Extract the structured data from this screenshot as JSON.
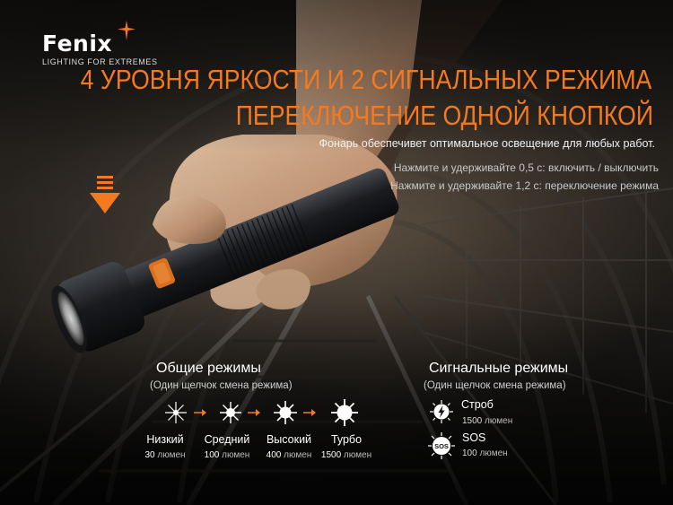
{
  "brand": {
    "name": "Fenix",
    "tagline": "LIGHTING FOR EXTREMES"
  },
  "headline": {
    "line1": "4 УРОВНЯ ЯРКОСТИ И 2 СИГНАЛЬНЫХ РЕЖИМА",
    "line2": "ПЕРЕКЛЮЧЕНИЕ ОДНОЙ КНОПКОЙ",
    "subtitle": "Фонарь обеспечивет оптимальное освещение для любых работ."
  },
  "instructions": [
    "Нажмите и удерживайте 0,5 с: включить / выключить",
    "Нажмите и удерживайте 1,2 с: переключение режима"
  ],
  "general_modes": {
    "title": "Общие  режимы",
    "subtitle": "(Один щелчок смена режима)",
    "modes": [
      {
        "name": "Низкий",
        "lumens": "30",
        "unit": "люмен"
      },
      {
        "name": "Средний",
        "lumens": "100",
        "unit": "люмен"
      },
      {
        "name": "Высокий",
        "lumens": "400",
        "unit": "люмен"
      },
      {
        "name": "Турбо",
        "lumens": "1500",
        "unit": "люмен"
      }
    ]
  },
  "signal_modes": {
    "title": "Сигнальные режимы",
    "subtitle": "(Один щелчок смена режима)",
    "modes": [
      {
        "name": "Строб",
        "lumens": "1500",
        "unit": "люмен"
      },
      {
        "name": "SOS",
        "lumens": "100",
        "unit": "люмен"
      }
    ],
    "sos_icon_text": "SOS"
  },
  "colors": {
    "accent": "#f47a20",
    "text": "#ffffff"
  },
  "icons": [
    "fenix-star-logo-icon",
    "down-arrow-icon",
    "light-burst-icon",
    "orange-arrow-icon",
    "lightning-icon",
    "sos-icon"
  ]
}
